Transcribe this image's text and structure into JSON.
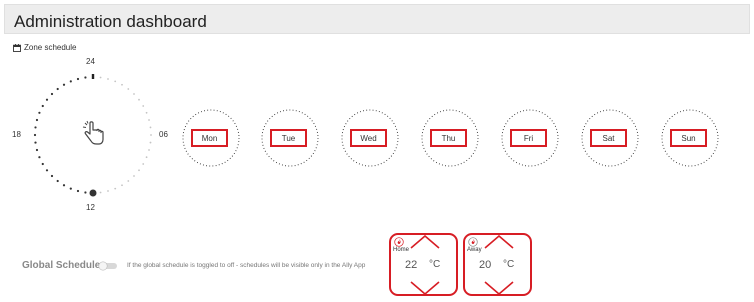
{
  "header": {
    "title": "Administration dashboard"
  },
  "zone": {
    "label": "Zone schedule",
    "icon": "calendar-icon"
  },
  "clock": {
    "labels": {
      "top": "24",
      "right": "06",
      "bottom": "12",
      "left": "18"
    },
    "center_icon": "hand-pointer-icon"
  },
  "days": [
    "Mon",
    "Tue",
    "Wed",
    "Thu",
    "Fri",
    "Sat",
    "Sun"
  ],
  "global_schedule": {
    "label": "Global Schedule",
    "enabled": false,
    "note": "If the global schedule is toggled to off - schedules will be visible only in the Ally App"
  },
  "thermostats": [
    {
      "mode": "Home",
      "temperature": "22",
      "unit": "°C",
      "icon": "flame-icon"
    },
    {
      "mode": "Away",
      "temperature": "20",
      "unit": "°C",
      "icon": "flame-icon"
    }
  ],
  "colors": {
    "accent": "#d71d24",
    "header_bg": "#ededed"
  }
}
